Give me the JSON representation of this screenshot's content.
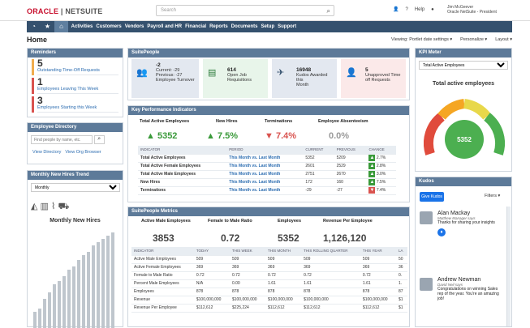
{
  "brand": {
    "oracle": "ORACLE",
    "sep": " | ",
    "netsuite": "NETSUITE"
  },
  "search": {
    "placeholder": "Search"
  },
  "topbar": {
    "help": "Help"
  },
  "user": {
    "name": "Jim McGeever",
    "role": "Oracle NetSuite - President"
  },
  "nav": [
    "Activities",
    "Customers",
    "Vendors",
    "Payroll and HR",
    "Financial",
    "Reports",
    "Documents",
    "Setup",
    "Support"
  ],
  "page": {
    "title": "Home",
    "viewing": "Viewing: Portlet date settings ▾",
    "personalize": "Personalize ▾",
    "layout": "Layout ▾"
  },
  "reminders": {
    "title": "Reminders",
    "items": [
      {
        "count": "5",
        "label": "Outstanding Time-Off Requests"
      },
      {
        "count": "1",
        "label": "Employees Leaving This Week"
      },
      {
        "count": "3",
        "label": "Employees Starting this Week"
      }
    ]
  },
  "directory": {
    "title": "Employee Directory",
    "placeholder": "Find people by name, etc.",
    "view_directory": "View Directory",
    "view_org": "View Org Browser"
  },
  "hires": {
    "title": "Monthly New Hires Trend",
    "period": "Monthly",
    "chart_title": "Monthly New Hires"
  },
  "suitepeople": {
    "title": "SuitePeople",
    "tiles": [
      {
        "value": "-2",
        "line1": "Current: -29",
        "line2": "Previous: -27",
        "line3": "Employee Turnover"
      },
      {
        "value": "614",
        "line1": "Open Job",
        "line2": "Requisitions"
      },
      {
        "value": "16948",
        "line1": "Kudos Awarded this",
        "line2": "Month"
      },
      {
        "value": "5",
        "line1": "Unapproved Time",
        "line2": "off Requests"
      }
    ]
  },
  "kpi": {
    "title": "Key Performance Indicators",
    "headlines": [
      {
        "label": "Total Active Employees",
        "value": "5352",
        "dir": "up"
      },
      {
        "label": "New Hires",
        "value": "7.5%",
        "dir": "up"
      },
      {
        "label": "Terminations",
        "value": "7.4%",
        "dir": "down"
      },
      {
        "label": "Employee Absenteeism",
        "value": "0.0%",
        "dir": "none"
      }
    ],
    "columns": [
      "INDICATOR",
      "PERIOD",
      "CURRENT",
      "PREVIOUS",
      "CHANGE"
    ],
    "rows": [
      {
        "indicator": "Total Active Employees",
        "period": "This Month vs. Last Month",
        "current": "5352",
        "previous": "5209",
        "dir": "up",
        "change": "2.7%"
      },
      {
        "indicator": "Total Active Female Employees",
        "period": "This Month vs. Last Month",
        "current": "2601",
        "previous": "2529",
        "dir": "up",
        "change": "2.8%"
      },
      {
        "indicator": "Total Active Male Employees",
        "period": "This Month vs. Last Month",
        "current": "2751",
        "previous": "2670",
        "dir": "up",
        "change": "3.0%"
      },
      {
        "indicator": "New Hires",
        "period": "This Month vs. Last Month",
        "current": "172",
        "previous": "160",
        "dir": "up",
        "change": "7.5%"
      },
      {
        "indicator": "Terminations",
        "period": "This Month vs. Last Month",
        "current": "-29",
        "previous": "-27",
        "dir": "down",
        "change": "7.4%"
      }
    ]
  },
  "metrics": {
    "title": "SuitePeople Metrics",
    "headlines": [
      {
        "label": "Active Male Employees",
        "value": "3853"
      },
      {
        "label": "Female to Male Ratio",
        "value": "0.72"
      },
      {
        "label": "Employees",
        "value": "5352"
      },
      {
        "label": "Revenue Per Employee",
        "value": "1,126,120"
      }
    ],
    "columns": [
      "INDICATOR",
      "TODAY",
      "THIS WEEK",
      "THIS MONTH",
      "THIS ROLLING QUARTER",
      "THIS YEAR",
      "LA"
    ],
    "rows": [
      [
        "Active Male Employees",
        "509",
        "509",
        "509",
        "509",
        "509",
        "50"
      ],
      [
        "Active Female Employees",
        "369",
        "369",
        "369",
        "369",
        "369",
        "36"
      ],
      [
        "Female to Male Ratio",
        "0.72",
        "0.72",
        "0.72",
        "0.72",
        "0.72",
        "0."
      ],
      [
        "Percent Male Employees",
        "N/A",
        "0.00",
        "1.61",
        "1.61",
        "1.61",
        "1."
      ],
      [
        "Employees",
        "878",
        "878",
        "878",
        "878",
        "878",
        "87"
      ],
      [
        "Revenue",
        "$100,000,000",
        "$100,000,000",
        "$100,000,000",
        "$100,000,000",
        "$100,000,000",
        "$1"
      ],
      [
        "Revenue Per Employee",
        "$112,612",
        "$225,224",
        "$112,612",
        "$112,612",
        "$112,612",
        "$1"
      ]
    ]
  },
  "meter": {
    "title": "KPI Meter",
    "select": "Total Active Employees",
    "label": "Total active employees",
    "value": "5352",
    "level": 0.62
  },
  "kudos": {
    "title": "Kudos",
    "give": "Give Kudos",
    "filters": "Filters ▾",
    "posts": [
      {
        "name": "Alan Mackay",
        "role": "Matthew Manager says",
        "msg": "Thanks for sharing your insights"
      },
      {
        "name": "Andrew Newman",
        "role": "David Neil says",
        "msg": "Congratulations on winning Sales rep of the year. You're an amazing job!"
      }
    ]
  },
  "colors": {
    "nav": "#35516e",
    "header": "#5d7a99",
    "accent": "#2b6cb0",
    "up": "#3a9a3a",
    "down": "#d9534f"
  }
}
